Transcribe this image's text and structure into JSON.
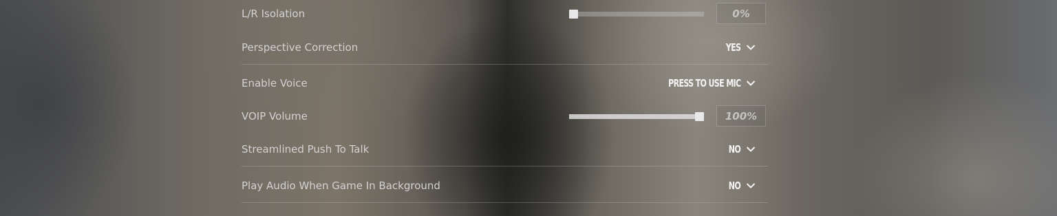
{
  "settings": {
    "lr_isolation": {
      "label": "L/R Isolation",
      "value_text": "0%",
      "level": 0
    },
    "perspective_correction": {
      "label": "Perspective Correction",
      "value": "YES",
      "icon": "chevron-down-icon"
    },
    "enable_voice": {
      "label": "Enable Voice",
      "value": "PRESS TO USE MIC",
      "icon": "chevron-down-icon"
    },
    "voip_volume": {
      "label": "VOIP Volume",
      "value_text": "100%",
      "level": 1.0
    },
    "streamlined_push_to_talk": {
      "label": "Streamlined Push To Talk",
      "value": "NO",
      "icon": "chevron-down-icon"
    },
    "play_audio_background": {
      "label": "Play Audio When Game In Background",
      "value": "NO",
      "icon": "chevron-down-icon"
    }
  },
  "colors": {
    "label_text": "#d2d2d2",
    "dropdown_text": "#f2f2f2",
    "slider_handle": "#e8e8e8"
  }
}
